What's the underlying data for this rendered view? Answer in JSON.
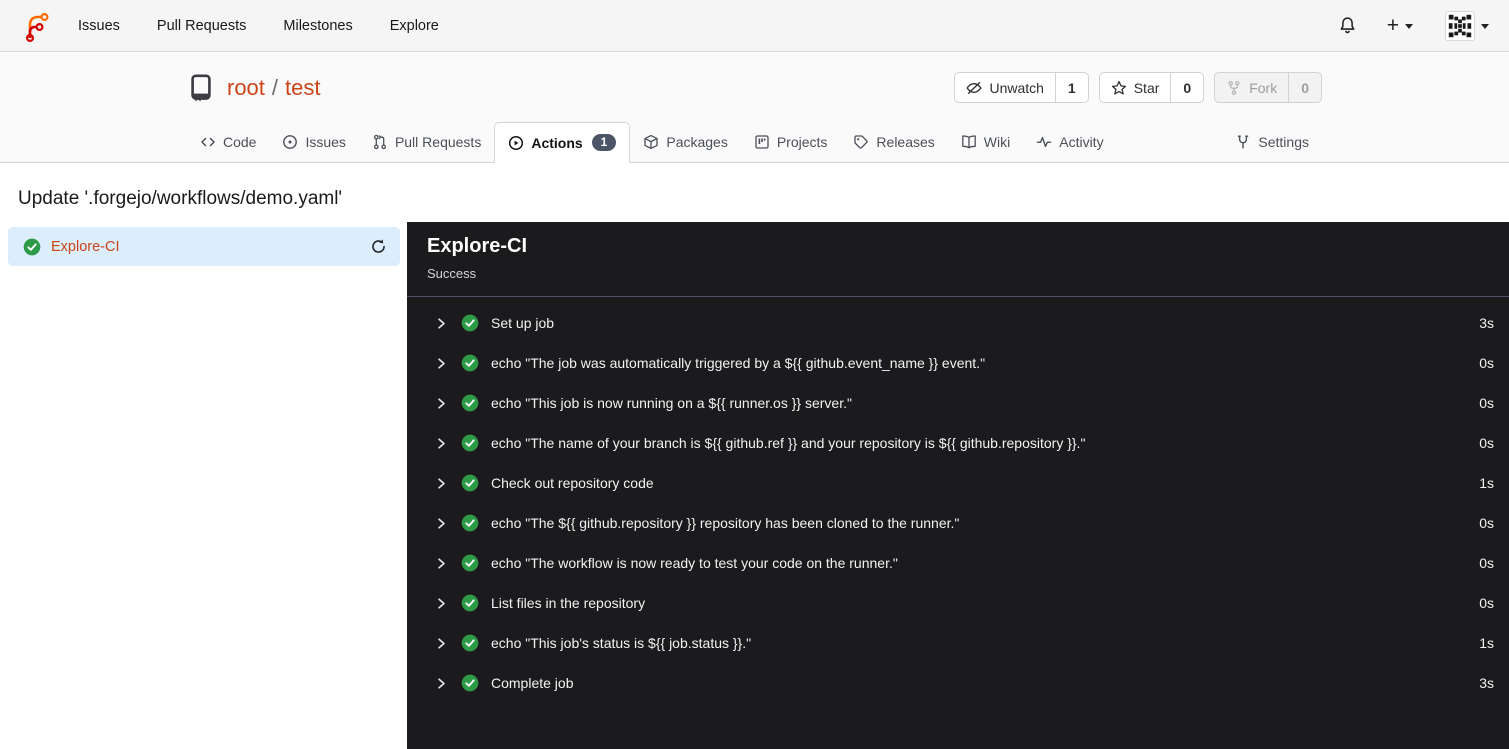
{
  "navbar": {
    "items": [
      {
        "label": "Issues"
      },
      {
        "label": "Pull Requests"
      },
      {
        "label": "Milestones"
      },
      {
        "label": "Explore"
      }
    ],
    "notifications_icon": "bell-icon",
    "create_icon": "plus-icon",
    "create_glyph": "+",
    "avatar_icon": "user-identicon-avatar"
  },
  "repo": {
    "icon": "repo-book-icon",
    "owner": "root",
    "separator": "/",
    "name": "test",
    "watch": {
      "icon": "eye-slash-icon",
      "label": "Unwatch",
      "count": "1"
    },
    "star": {
      "icon": "star-icon",
      "label": "Star",
      "count": "0"
    },
    "fork": {
      "icon": "fork-icon",
      "label": "Fork",
      "count": "0",
      "disabled": true
    },
    "tabs": [
      {
        "label": "Code",
        "icon": "code-icon"
      },
      {
        "label": "Issues",
        "icon": "issue-circle-icon"
      },
      {
        "label": "Pull Requests",
        "icon": "pull-request-icon"
      },
      {
        "label": "Actions",
        "icon": "play-circle-icon",
        "badge": "1",
        "active": true
      },
      {
        "label": "Packages",
        "icon": "package-icon"
      },
      {
        "label": "Projects",
        "icon": "project-board-icon"
      },
      {
        "label": "Releases",
        "icon": "tag-icon"
      },
      {
        "label": "Wiki",
        "icon": "book-open-icon"
      },
      {
        "label": "Activity",
        "icon": "pulse-icon"
      },
      {
        "label": "Settings",
        "icon": "tool-icon"
      }
    ]
  },
  "run": {
    "title": "Update '.forgejo/workflows/demo.yaml'",
    "sidebar_job": {
      "name": "Explore-CI",
      "status_icon": "success-check-icon",
      "refresh_icon": "refresh-icon"
    },
    "panel": {
      "title": "Explore-CI",
      "status": "Success"
    },
    "steps": [
      {
        "label": "Set up job",
        "duration": "3s"
      },
      {
        "label": "echo \"The job was automatically triggered by a ${{ github.event_name }} event.\"",
        "duration": "0s"
      },
      {
        "label": "echo \"This job is now running on a ${{ runner.os }} server.\"",
        "duration": "0s"
      },
      {
        "label": "echo \"The name of your branch is ${{ github.ref }} and your repository is ${{ github.repository }}.\"",
        "duration": "0s"
      },
      {
        "label": "Check out repository code",
        "duration": "1s"
      },
      {
        "label": "echo \"The ${{ github.repository }} repository has been cloned to the runner.\"",
        "duration": "0s"
      },
      {
        "label": "echo \"The workflow is now ready to test your code on the runner.\"",
        "duration": "0s"
      },
      {
        "label": "List files in the repository",
        "duration": "0s"
      },
      {
        "label": "echo \"This job's status is ${{ job.status }}.\"",
        "duration": "1s"
      },
      {
        "label": "Complete job",
        "duration": "3s"
      }
    ]
  },
  "colors": {
    "accent_link": "#cc4418",
    "success_green": "#2c9a46",
    "panel_background": "#1b1b1d",
    "selected_job_background": "#dcedfb",
    "badge_background": "#4c5566",
    "logo_orange": "#ff6b00",
    "logo_red": "#d40000"
  }
}
